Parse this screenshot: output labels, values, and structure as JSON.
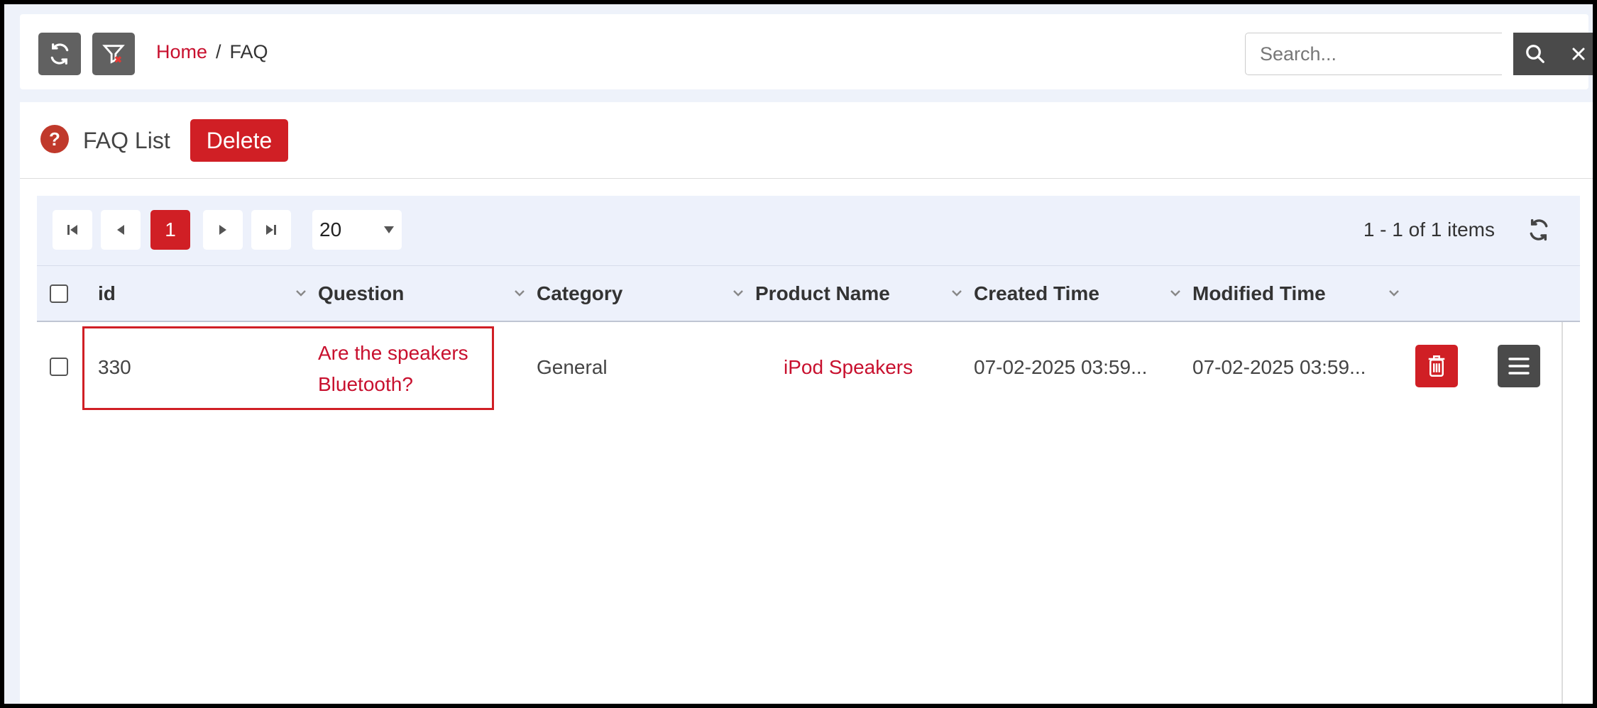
{
  "breadcrumb": {
    "home": "Home",
    "separator": "/",
    "current": "FAQ"
  },
  "search": {
    "placeholder": "Search..."
  },
  "panel": {
    "title": "FAQ List",
    "delete_label": "Delete"
  },
  "pager": {
    "current_page": "1",
    "page_size": "20",
    "info": "1 - 1 of 1 items"
  },
  "columns": [
    "id",
    "Question",
    "Category",
    "Product Name",
    "Created Time",
    "Modified Time"
  ],
  "rows": [
    {
      "id": "330",
      "question_line1": "Are the speakers",
      "question_line2": "Bluetooth?",
      "category": "General",
      "product_name": "iPod Speakers",
      "created_time": "07-02-2025 03:59...",
      "modified_time": "07-02-2025 03:59..."
    }
  ],
  "colors": {
    "accent": "#d01f25",
    "dark_button": "#616161",
    "header_bg": "#edf1fb"
  }
}
